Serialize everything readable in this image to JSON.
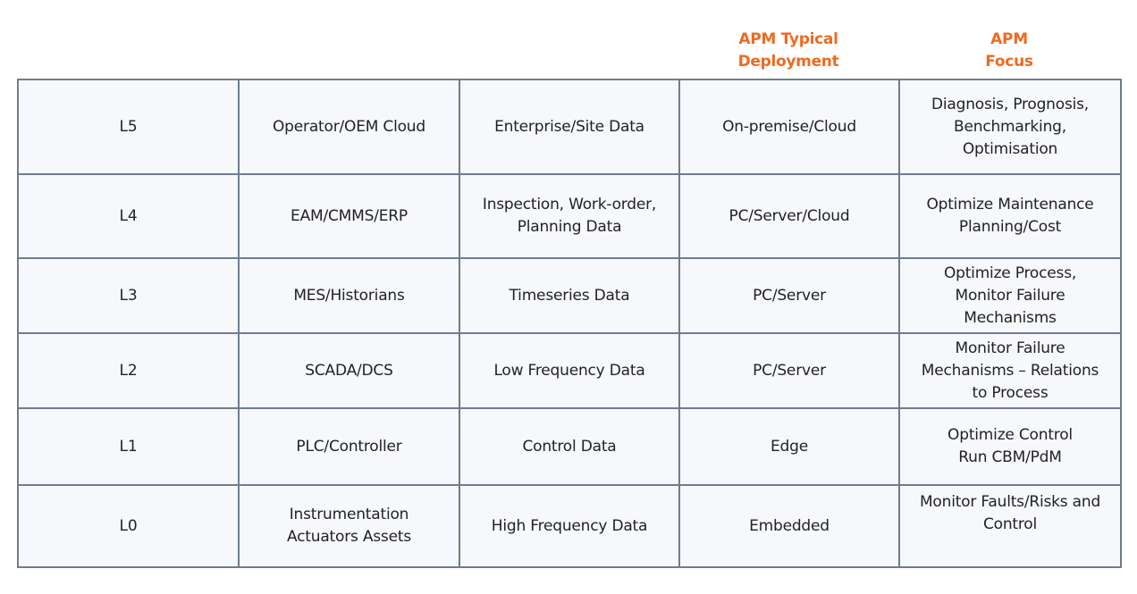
{
  "headers": {
    "deployment": "APM Typical\nDeployment",
    "focus": "APM\nFocus",
    "accent_color": "#ee6a1f"
  },
  "rows": [
    {
      "level": "L5",
      "system": "Operator/OEM Cloud",
      "data": "Enterprise/Site Data",
      "deployment": "On-premise/Cloud",
      "focus": "Diagnosis, Prognosis,\nBenchmarking,\nOptimisation"
    },
    {
      "level": "L4",
      "system": "EAM/CMMS/ERP",
      "data": "Inspection, Work-order,\nPlanning Data",
      "deployment": "PC/Server/Cloud",
      "focus": "Optimize Maintenance\nPlanning/Cost"
    },
    {
      "level": "L3",
      "system": "MES/Historians",
      "data": "Timeseries Data",
      "deployment": "PC/Server",
      "focus": "Optimize Process,\nMonitor Failure\nMechanisms"
    },
    {
      "level": "L2",
      "system": "SCADA/DCS",
      "data": "Low Frequency Data",
      "deployment": "PC/Server",
      "focus": "Monitor Failure\nMechanisms – Relations\nto Process"
    },
    {
      "level": "L1",
      "system": "PLC/Controller",
      "data": "Control Data",
      "deployment": "Edge",
      "focus": "Optimize Control\nRun CBM/PdM"
    },
    {
      "level": "L0",
      "system": "Instrumentation\nActuators Assets",
      "data": "High Frequency Data",
      "deployment": "Embedded",
      "focus": "Monitor Faults/Risks and\nControl"
    }
  ]
}
